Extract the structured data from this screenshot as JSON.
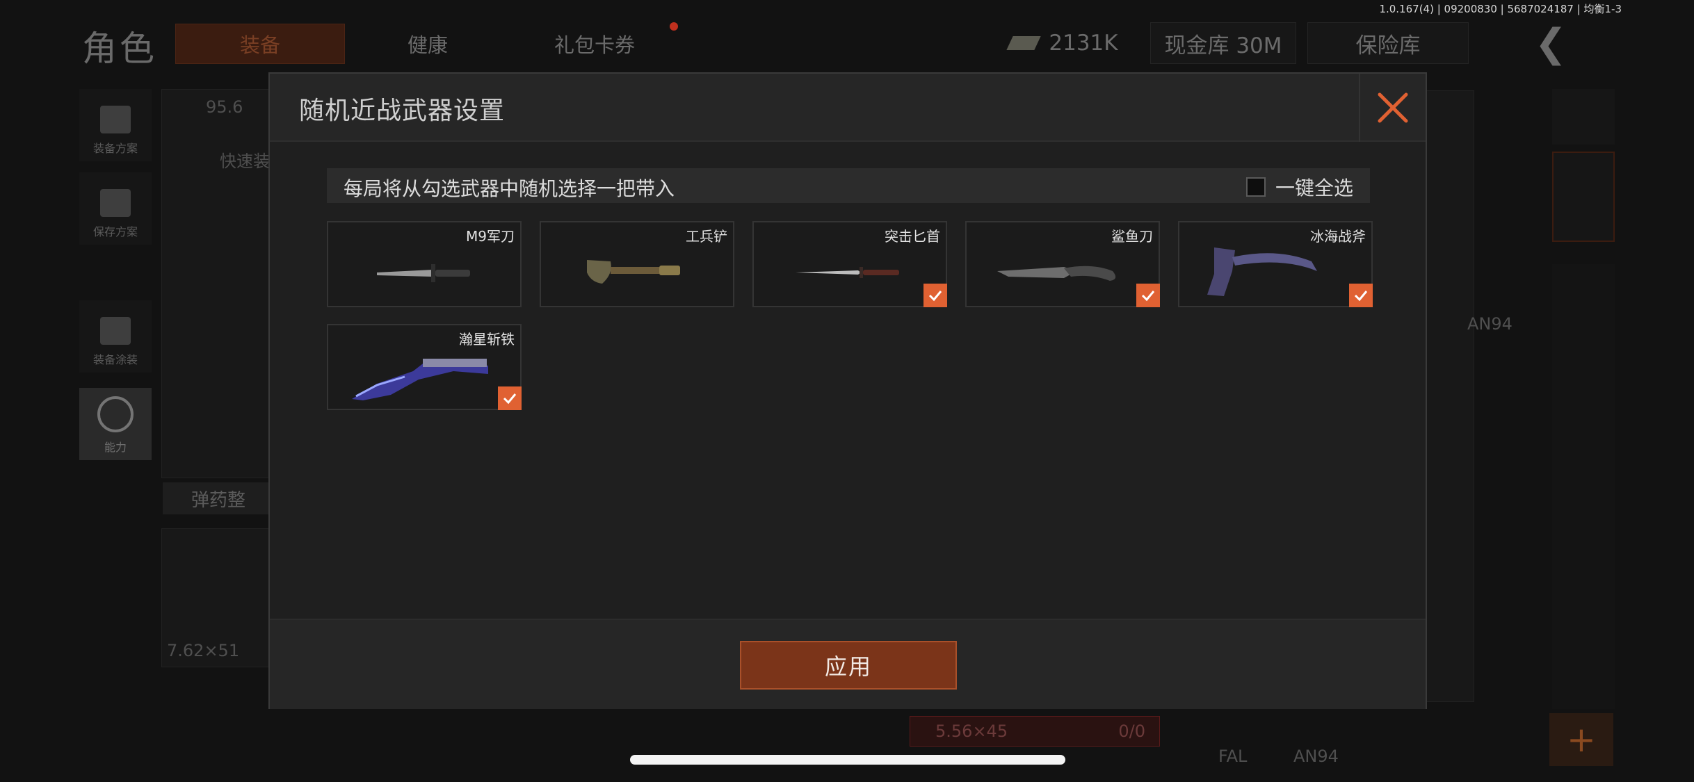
{
  "status": {
    "version_text": "1.0.167(4) | 09200830 | 5687024187 | 均衡1-3"
  },
  "background": {
    "page_title": "角色",
    "tabs": [
      {
        "label": "装备",
        "active": true
      },
      {
        "label": "健康"
      },
      {
        "label": "礼包卡券"
      }
    ],
    "money": "2131K",
    "cash_vault": "现金库 30M",
    "safe_box": "保险库",
    "back_icon": "chevron-left-icon",
    "left_menu": [
      {
        "label": "装备方案",
        "icon": "vest-icon"
      },
      {
        "label": "保存方案",
        "icon": "download-icon"
      },
      {
        "label": "装备涂装",
        "icon": "helmet-icon"
      },
      {
        "label": "能力",
        "icon": "lightning-icon"
      }
    ],
    "quick_equip": "快速装",
    "ammo_tab": "弹药整",
    "caliber_1": "7.62×51",
    "caliber_2": "5.56×45",
    "ammo_count": "0/0",
    "weapon_top": "AN94",
    "weapon_fal": "FAL",
    "weapon_an94": "AN94",
    "stat_value": "95.6"
  },
  "modal": {
    "title": "随机近战武器设置",
    "close_icon": "close-icon",
    "info_text": "每局将从勾选武器中随机选择一把带入",
    "select_all_label": "一键全选",
    "select_all_checked": false,
    "accent_color": "#e06132",
    "weapons": [
      {
        "name": "M9军刀",
        "icon": "combat-knife-icon",
        "checked": false
      },
      {
        "name": "工兵铲",
        "icon": "shovel-icon",
        "checked": false
      },
      {
        "name": "突击匕首",
        "icon": "dagger-icon",
        "checked": true
      },
      {
        "name": "鲨鱼刀",
        "icon": "serrated-knife-icon",
        "checked": true
      },
      {
        "name": "冰海战斧",
        "icon": "tomahawk-icon",
        "checked": true
      },
      {
        "name": "瀚星斩铁",
        "icon": "kukri-icon",
        "checked": true
      }
    ],
    "apply_label": "应用"
  }
}
